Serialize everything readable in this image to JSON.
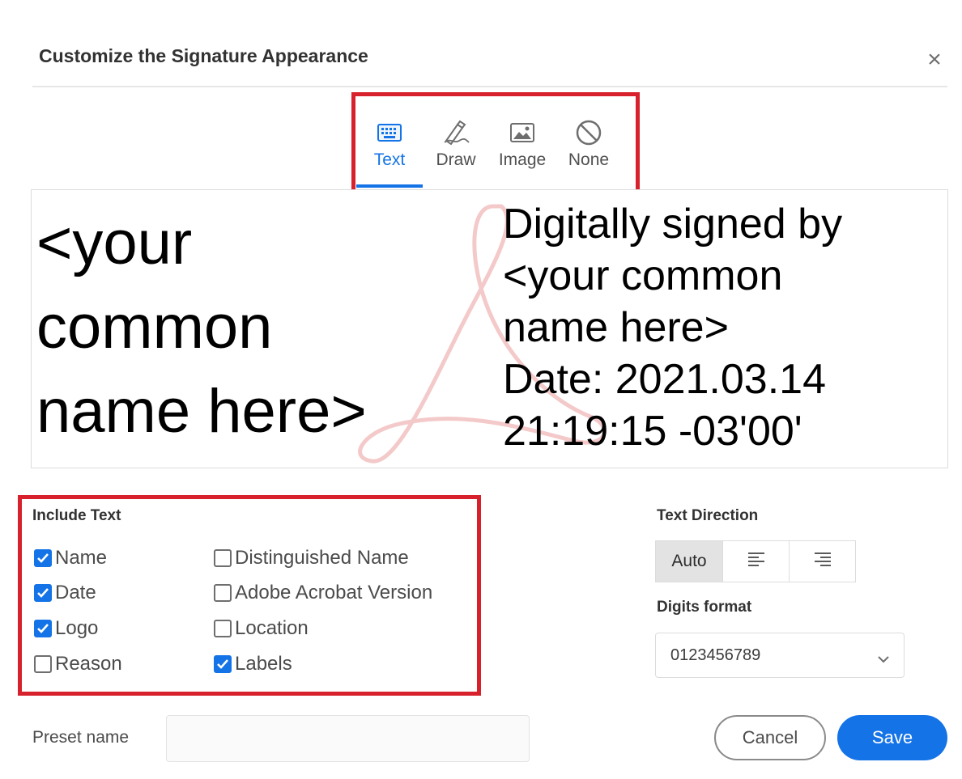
{
  "dialog": {
    "title": "Customize the Signature Appearance",
    "close_glyph": "×"
  },
  "tabs": [
    {
      "label": "Text",
      "icon": "keyboard-icon",
      "active": true
    },
    {
      "label": "Draw",
      "icon": "pen-icon",
      "active": false
    },
    {
      "label": "Image",
      "icon": "image-icon",
      "active": false
    },
    {
      "label": "None",
      "icon": "none-icon",
      "active": false
    }
  ],
  "preview": {
    "name_lines": [
      "<your",
      "common",
      "name here>"
    ],
    "detail_lines": [
      "Digitally signed by",
      "<your common",
      "name here>",
      "Date: 2021.03.14",
      "21:19:15 -03'00'"
    ],
    "watermark_color": "#f4c9c9"
  },
  "include_text": {
    "title": "Include Text",
    "options": [
      {
        "label": "Name",
        "checked": true
      },
      {
        "label": "Date",
        "checked": true
      },
      {
        "label": "Logo",
        "checked": true
      },
      {
        "label": "Reason",
        "checked": false
      },
      {
        "label": "Distinguished Name",
        "checked": false
      },
      {
        "label": "Adobe Acrobat Version",
        "checked": false
      },
      {
        "label": "Location",
        "checked": false
      },
      {
        "label": "Labels",
        "checked": true
      }
    ]
  },
  "text_direction": {
    "title": "Text Direction",
    "options": [
      {
        "label": "Auto",
        "icon": "",
        "selected": true
      },
      {
        "label": "",
        "icon": "align-left-icon",
        "selected": false
      },
      {
        "label": "",
        "icon": "align-right-icon",
        "selected": false
      }
    ]
  },
  "digits_format": {
    "title": "Digits format",
    "value": "0123456789"
  },
  "preset": {
    "label": "Preset name",
    "value": "",
    "placeholder": ""
  },
  "buttons": {
    "cancel": "Cancel",
    "save": "Save"
  },
  "colors": {
    "accent": "#1473e6",
    "highlight": "#d7222d"
  }
}
